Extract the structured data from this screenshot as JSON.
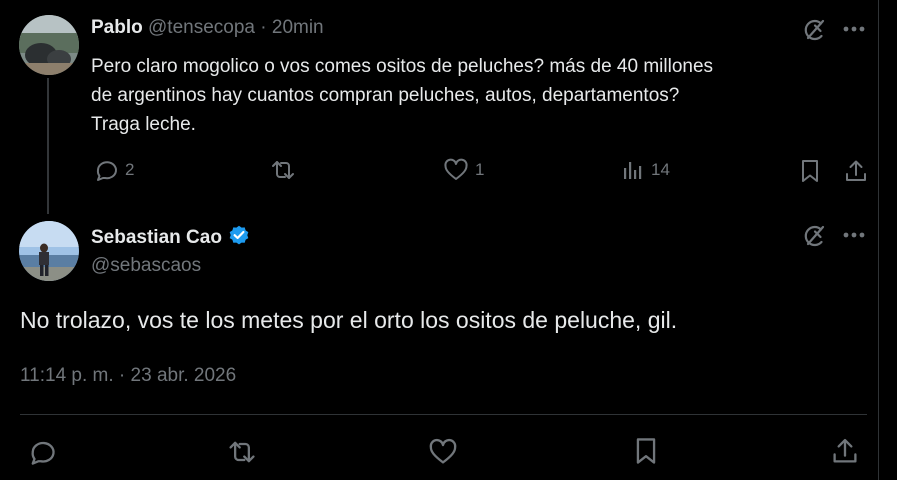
{
  "reply_tweet": {
    "author_name": "Pablo",
    "author_handle": "@tensecopa",
    "separator": "·",
    "time_ago": "20min",
    "text_lines": [
      "Pero claro mogolico o vos comes ositos de peluches? más de 40 millones",
      "de argentinos hay cuantos compran peluches, autos, departamentos?",
      "Traga leche."
    ],
    "actions": {
      "reply_count": "2",
      "retweet_count": "",
      "like_count": "1",
      "views_count": "14"
    }
  },
  "main_tweet": {
    "author_name": "Sebastian Cao",
    "author_handle": "@sebascaos",
    "verified": true,
    "text": "No trolazo, vos te los metes por el orto los ositos de peluche, gil.",
    "timestamp": "11:14 p. m. · 23 abr. 2026"
  },
  "colors": {
    "background": "#000000",
    "text": "#e7e9ea",
    "muted": "#71767b",
    "verified_badge": "#1d9bf0",
    "divider": "#2f3336"
  },
  "icons": {
    "grok": "grok-icon",
    "more": "more-icon",
    "reply": "reply-icon",
    "retweet": "retweet-icon",
    "like": "heart-icon",
    "views": "views-icon",
    "bookmark": "bookmark-icon",
    "share": "share-icon",
    "verified": "verified-badge-icon"
  }
}
